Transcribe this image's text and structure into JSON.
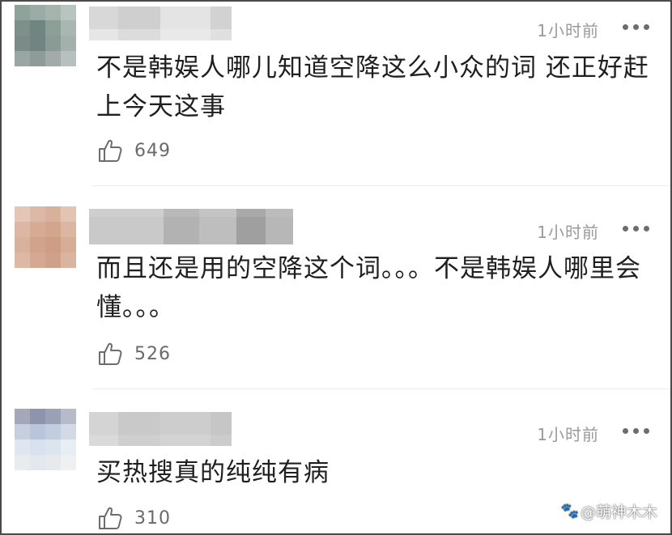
{
  "comments": [
    {
      "time": "1小时前",
      "text": "不是韩娱人哪儿知道空降这么小众的词 还正好赶上今天这事",
      "likes": "649",
      "avatar_colors": [
        "#8fa39b",
        "#9aaca5",
        "#a5b5ae",
        "#b8c4bf",
        "#7d918a",
        "#6f8580",
        "#8c9e98",
        "#a9b7b2",
        "#7a8b88",
        "#718481",
        "#8a9a97",
        "#a4b0ad",
        "#9aa6a4",
        "#8e9b99",
        "#a1acaa",
        "#b7c0be"
      ],
      "username_colors": [
        [
          "#d8d8d8",
          "#cfcfcf",
          "#e4e4e4",
          "#d2d2d2"
        ],
        [
          "#e6e6e6",
          "#dcdcdc",
          "#e9e9e9",
          "#e0e0e0"
        ]
      ]
    },
    {
      "time": "1小时前",
      "text": "而且还是用的空降这个词。。。不是韩娱人哪里会懂。。。",
      "likes": "526",
      "avatar_colors": [
        "#e3c6b6",
        "#dcb9a6",
        "#d8b19c",
        "#e2c4b3",
        "#dcb8a4",
        "#d6ab94",
        "#d2a58d",
        "#dbb6a1",
        "#d9b29d",
        "#d1a38b",
        "#cd9d84",
        "#d6ad97",
        "#dcb8a5",
        "#d4a892",
        "#d0a18a",
        "#d9b4a1"
      ],
      "username_colors": [
        [
          "#cfcfcf",
          "#b9b9b9",
          "#c4c4c4",
          "#a9a9a9",
          "#bcbcbc"
        ],
        [
          "#c9c9c9",
          "#b2b2b2",
          "#bebebe",
          "#9f9f9f",
          "#b7b7b7"
        ]
      ]
    },
    {
      "time": "1小时前",
      "text": "买热搜真的纯纯有病",
      "likes": "310",
      "avatar_colors": [
        "#a4a8b8",
        "#8e94ab",
        "#9aa0b5",
        "#b7bbc9",
        "#c7cfde",
        "#b8c5da",
        "#c1cee0",
        "#d3dae6",
        "#dfe6ef",
        "#d7e2ee",
        "#dbe5f0",
        "#e8edf3",
        "#e9ecef",
        "#e3e8ee",
        "#e6eaee",
        "#eef0f2"
      ],
      "username_colors": [
        [
          "#d4d4d4",
          "#c9c9c9",
          "#cdcdcd",
          "#c6c6c6"
        ],
        [
          "#dadada",
          "#cfcfcf",
          "#d3d3d3",
          "#cccccc"
        ]
      ]
    }
  ],
  "watermark": {
    "text": "@萌神木木",
    "icon": "paw-icon"
  },
  "colors": {
    "border": "#4a4a4a",
    "text": "#1f1f1f",
    "meta": "#9a9a9a",
    "icon": "#6d6d6d"
  }
}
